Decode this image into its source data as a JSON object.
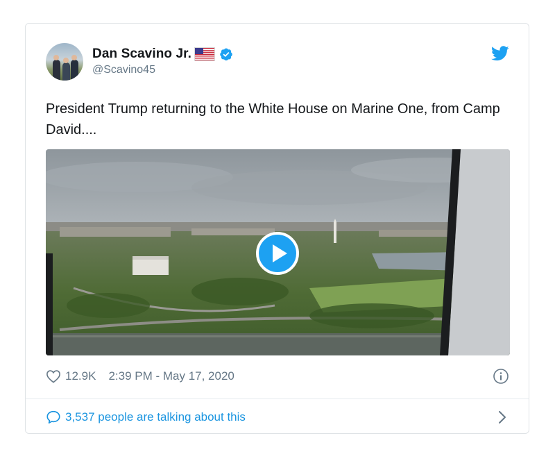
{
  "tweet": {
    "author": {
      "name": "Dan Scavino Jr.",
      "handle": "@Scavino45",
      "avatar_icon": "profile-photo",
      "flag_icon": "us-flag-emoji",
      "verified_icon": "verified-badge-icon"
    },
    "brand_icon": "twitter-bird-icon",
    "text": "President Trump returning to the White House on Marine One, from Camp David....",
    "media": {
      "type": "video",
      "thumbnail": "aerial-view-of-washington-dc",
      "play_icon": "play-icon"
    },
    "likes": "12.9K",
    "timestamp": "2:39 PM - May 17, 2020",
    "info_icon": "info-icon",
    "conversation": {
      "label": "3,537 people are talking about this",
      "icon": "speech-bubble-icon",
      "chevron_icon": "chevron-right-icon"
    }
  },
  "colors": {
    "twitter_blue": "#1da1f2",
    "link_blue": "#1b95e0",
    "secondary_text": "#657786",
    "border": "#dfe3e6"
  }
}
